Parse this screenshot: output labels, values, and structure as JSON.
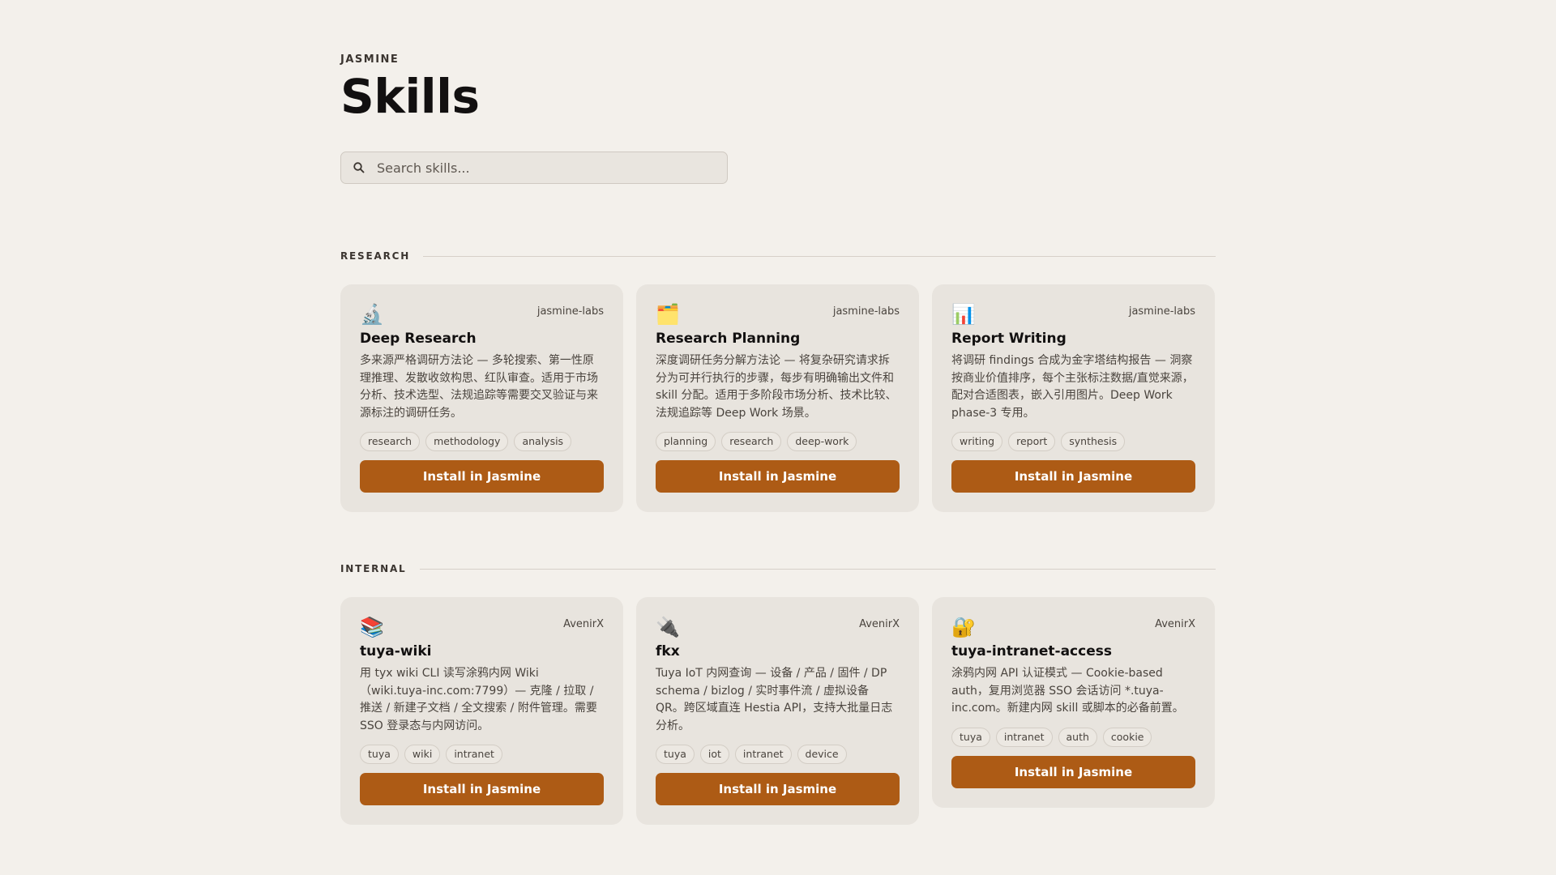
{
  "header": {
    "eyebrow": "JASMINE",
    "title": "Skills"
  },
  "search": {
    "placeholder": "Search skills..."
  },
  "sections": [
    {
      "title": "RESEARCH",
      "cards": [
        {
          "icon": "microscope-icon",
          "emoji": "🔬",
          "author": "jasmine-labs",
          "title": "Deep Research",
          "description": "多来源严格调研方法论 — 多轮搜索、第一性原理推理、发散收敛构思、红队审查。适用于市场分析、技术选型、法规追踪等需要交叉验证与来源标注的调研任务。",
          "tags": [
            "research",
            "methodology",
            "analysis"
          ],
          "button": "Install in Jasmine"
        },
        {
          "icon": "card-index-dividers-icon",
          "emoji": "🗂️",
          "author": "jasmine-labs",
          "title": "Research Planning",
          "description": "深度调研任务分解方法论 — 将复杂研究请求拆分为可并行执行的步骤，每步有明确输出文件和 skill 分配。适用于多阶段市场分析、技术比较、法规追踪等 Deep Work 场景。",
          "tags": [
            "planning",
            "research",
            "deep-work"
          ],
          "button": "Install in Jasmine"
        },
        {
          "icon": "bar-chart-icon",
          "emoji": "📊",
          "author": "jasmine-labs",
          "title": "Report Writing",
          "description": "将调研 findings 合成为金字塔结构报告 — 洞察按商业价值排序，每个主张标注数据/直觉来源，配对合适图表，嵌入引用图片。Deep Work phase-3 专用。",
          "tags": [
            "writing",
            "report",
            "synthesis"
          ],
          "button": "Install in Jasmine"
        }
      ]
    },
    {
      "title": "INTERNAL",
      "cards": [
        {
          "icon": "books-icon",
          "emoji": "📚",
          "author": "AvenirX",
          "title": "tuya-wiki",
          "description": "用 tyx wiki CLI 读写涂鸦内网 Wiki（wiki.tuya-inc.com:7799）— 克隆 / 拉取 / 推送 / 新建子文档 / 全文搜索 / 附件管理。需要 SSO 登录态与内网访问。",
          "tags": [
            "tuya",
            "wiki",
            "intranet"
          ],
          "button": "Install in Jasmine"
        },
        {
          "icon": "plug-icon",
          "emoji": "🔌",
          "author": "AvenirX",
          "title": "fkx",
          "description": "Tuya IoT 内网查询 — 设备 / 产品 / 固件 / DP schema / bizlog / 实时事件流 / 虚拟设备 QR。跨区域直连 Hestia API，支持大批量日志分析。",
          "tags": [
            "tuya",
            "iot",
            "intranet",
            "device"
          ],
          "button": "Install in Jasmine"
        },
        {
          "icon": "lock-with-key-icon",
          "emoji": "🔐",
          "author": "AvenirX",
          "title": "tuya-intranet-access",
          "description": "涂鸦内网 API 认证模式 — Cookie-based auth，复用浏览器 SSO 会话访问 *.tuya-inc.com。新建内网 skill 或脚本的必备前置。",
          "tags": [
            "tuya",
            "intranet",
            "auth",
            "cookie"
          ],
          "button": "Install in Jasmine"
        }
      ]
    }
  ]
}
